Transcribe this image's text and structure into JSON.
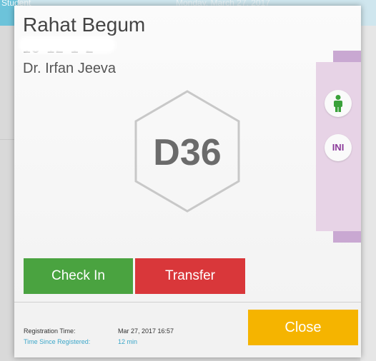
{
  "background": {
    "header_left_text": "Student",
    "header_date_text": "Monday, March 27, 2017"
  },
  "card": {
    "patient_name": "Rahat Begum",
    "patient_id": "15-12-1-2",
    "doctor_name": "Dr. Irfan Jeeva",
    "bed_code": "D36"
  },
  "side_panel": {
    "person_icon": "person-icon",
    "ini_label": "INI"
  },
  "actions": {
    "checkin_label": "Check In",
    "transfer_label": "Transfer",
    "close_label": "Close"
  },
  "footer": {
    "registration_time_label": "Registration Time:",
    "registration_time_value": "Mar 27, 2017 16:57",
    "time_since_label": "Time Since Registered:",
    "time_since_value": "12 min"
  },
  "colors": {
    "checkin": "#4aa340",
    "transfer": "#d9373a",
    "close": "#f5b400",
    "side_panel": "#e7d3e6",
    "side_tab": "#c9a8d2",
    "accent_text": "#3ca7c9"
  }
}
